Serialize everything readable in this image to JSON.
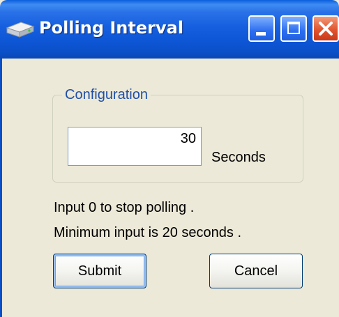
{
  "window": {
    "title": "Polling Interval",
    "icon": "network-drive-icon",
    "controls": {
      "minimize": "minimize-icon",
      "maximize": "maximize-icon",
      "close": "close-icon"
    }
  },
  "configuration": {
    "group_label": "Configuration",
    "interval_value": "30",
    "unit_label": "Seconds"
  },
  "hints": {
    "stop": "Input 0 to stop polling .",
    "minimum": "Minimum input is 20 seconds ."
  },
  "buttons": {
    "submit": "Submit",
    "cancel": "Cancel"
  },
  "colors": {
    "titlebar": "#0b4fc6",
    "group_label": "#1f4fa8",
    "close_button": "#e0552e",
    "client_bg": "#ece9d8"
  }
}
